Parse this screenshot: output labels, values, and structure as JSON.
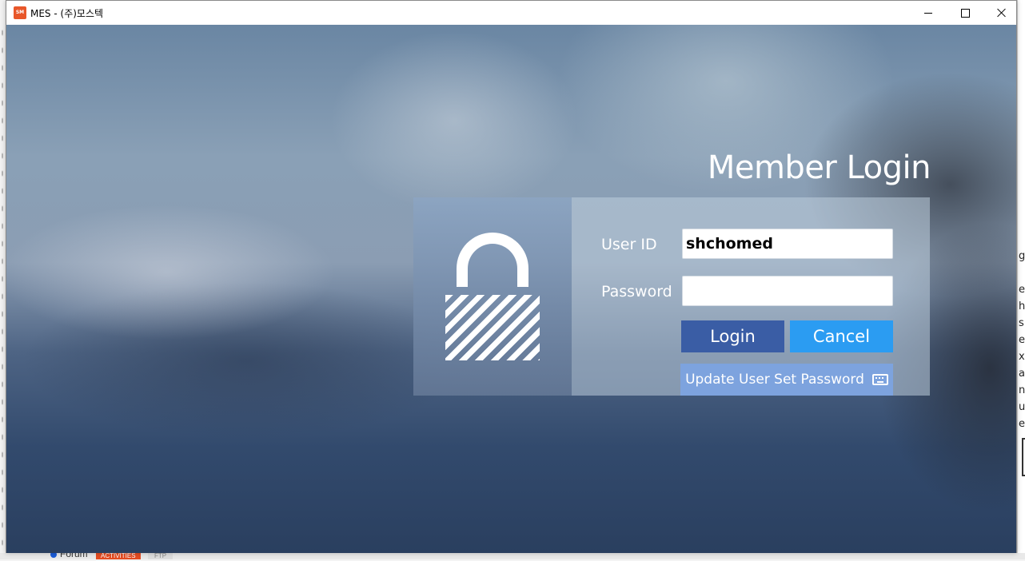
{
  "window": {
    "title": "MES - (주)모스텍",
    "icon": "app-logo-icon",
    "controls": [
      "minimize-icon",
      "maximize-icon",
      "close-icon"
    ]
  },
  "login": {
    "heading": "Member Login",
    "userid_label": "User ID",
    "userid_value": "shchomed",
    "password_label": "Password",
    "password_value": "",
    "login_button": "Login",
    "cancel_button": "Cancel",
    "update_button": "Update User Set Password"
  },
  "background_app": {
    "right_chars": [
      "g",
      "e",
      "h",
      "s",
      "e",
      "x",
      "a",
      "n",
      "u",
      "e"
    ],
    "forum_label": "Forum",
    "activities_tab": "ACTIVITIES",
    "ftp_tab": "FTP"
  },
  "colors": {
    "login_button": "#3a5da5",
    "cancel_button": "#2b9cf2",
    "update_button": "#7da3de",
    "title_icon": "#e8572a"
  }
}
